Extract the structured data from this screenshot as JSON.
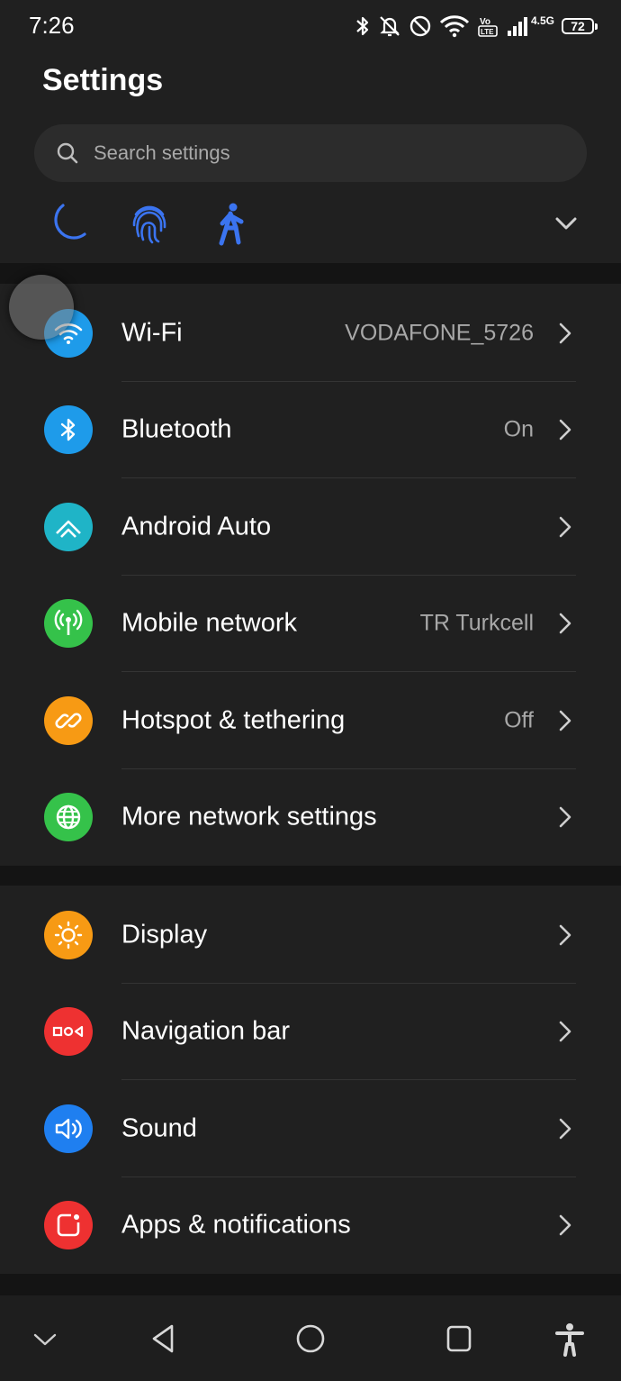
{
  "status_bar": {
    "time": "7:26",
    "network_type": "4.5G",
    "volte_label": "Vo LTE",
    "battery": "72"
  },
  "page_title": "Settings",
  "search": {
    "placeholder": "Search settings"
  },
  "quick_icons": [
    "moon-icon",
    "fingerprint-icon",
    "walking-person-icon"
  ],
  "sections": [
    {
      "items": [
        {
          "label": "Wi-Fi",
          "value": "VODAFONE_5726",
          "icon": "wifi-icon",
          "color": "#1e9bea"
        },
        {
          "label": "Bluetooth",
          "value": "On",
          "icon": "bluetooth-icon",
          "color": "#1e9bea"
        },
        {
          "label": "Android Auto",
          "value": "",
          "icon": "android-auto-icon",
          "color": "#1fb4c7"
        },
        {
          "label": "Mobile network",
          "value": "TR Turkcell",
          "icon": "antenna-icon",
          "color": "#35c24a"
        },
        {
          "label": "Hotspot & tethering",
          "value": "Off",
          "icon": "link-icon",
          "color": "#f79a14"
        },
        {
          "label": "More network settings",
          "value": "",
          "icon": "globe-icon",
          "color": "#35c24a"
        }
      ]
    },
    {
      "items": [
        {
          "label": "Display",
          "value": "",
          "icon": "sun-icon",
          "color": "#f79a14"
        },
        {
          "label": "Navigation bar",
          "value": "",
          "icon": "nav-bar-icon",
          "color": "#ee3131"
        },
        {
          "label": "Sound",
          "value": "",
          "icon": "speaker-icon",
          "color": "#1f7ff0"
        },
        {
          "label": "Apps & notifications",
          "value": "",
          "icon": "app-notification-icon",
          "color": "#ee3131"
        }
      ]
    }
  ],
  "colors": {
    "background": "#202020",
    "accent_blue": "#3b74f0"
  }
}
